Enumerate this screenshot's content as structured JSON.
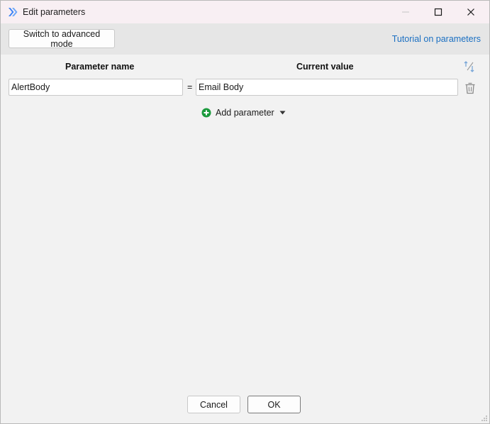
{
  "window": {
    "title": "Edit parameters",
    "icon": "app-chevrons-icon",
    "controls": [
      "minimize-icon",
      "maximize-icon",
      "close-icon"
    ]
  },
  "toolbar": {
    "advanced_mode_label": "Switch to advanced mode",
    "tutorial_link": "Tutorial on parameters"
  },
  "table": {
    "header_name": "Parameter name",
    "header_value": "Current value",
    "rows": [
      {
        "name": "AlertBody",
        "separator": "=",
        "value": "Email Body"
      }
    ]
  },
  "add_parameter": {
    "label": "Add parameter",
    "icon": "plus-circle-icon"
  },
  "footer": {
    "cancel_label": "Cancel",
    "ok_label": "OK"
  },
  "colors": {
    "titlebar_bg": "#f8eff3",
    "link": "#1a6fc2",
    "add_icon": "#1a9a3c",
    "app_icon": "#3b82f6"
  }
}
